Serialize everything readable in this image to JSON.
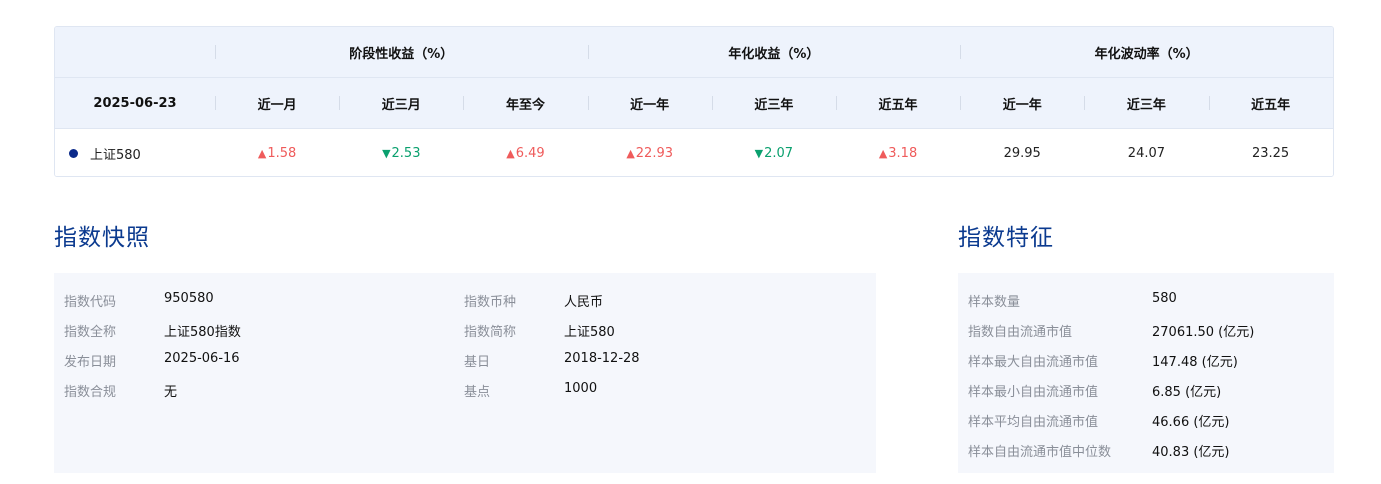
{
  "returns_table": {
    "date": "2025-06-23",
    "group_headers": [
      "阶段性收益（%）",
      "年化收益（%）",
      "年化波动率（%）"
    ],
    "sub_headers": [
      "近一月",
      "近三月",
      "年至今",
      "近一年",
      "近三年",
      "近五年",
      "近一年",
      "近三年",
      "近五年"
    ],
    "row": {
      "name": "上证580",
      "cells": [
        {
          "value": "1.58",
          "dir": "up"
        },
        {
          "value": "2.53",
          "dir": "down"
        },
        {
          "value": "6.49",
          "dir": "up"
        },
        {
          "value": "22.93",
          "dir": "up"
        },
        {
          "value": "2.07",
          "dir": "down"
        },
        {
          "value": "3.18",
          "dir": "up"
        },
        {
          "value": "29.95",
          "dir": "none"
        },
        {
          "value": "24.07",
          "dir": "none"
        },
        {
          "value": "23.25",
          "dir": "none"
        }
      ]
    },
    "colors": {
      "up": "#ef5b5b",
      "down": "#0aa06e",
      "dot": "#0b2a8a"
    }
  },
  "snapshot": {
    "title": "指数快照",
    "left": [
      {
        "label": "指数代码",
        "value": "950580"
      },
      {
        "label": "指数全称",
        "value": "上证580指数"
      },
      {
        "label": "发布日期",
        "value": "2025-06-16"
      },
      {
        "label": "指数合规",
        "value": "无"
      }
    ],
    "right": [
      {
        "label": "指数币种",
        "value": "人民币"
      },
      {
        "label": "指数简称",
        "value": "上证580"
      },
      {
        "label": "基日",
        "value": "2018-12-28"
      },
      {
        "label": "基点",
        "value": "1000"
      }
    ]
  },
  "features": {
    "title": "指数特征",
    "items": [
      {
        "label": "样本数量",
        "value": "580"
      },
      {
        "label": "指数自由流通市值",
        "value": "27061.50 (亿元)"
      },
      {
        "label": "样本最大自由流通市值",
        "value": "147.48 (亿元)"
      },
      {
        "label": "样本最小自由流通市值",
        "value": "6.85 (亿元)"
      },
      {
        "label": "样本平均自由流通市值",
        "value": "46.66 (亿元)"
      },
      {
        "label": "样本自由流通市值中位数",
        "value": "40.83 (亿元)"
      }
    ]
  }
}
